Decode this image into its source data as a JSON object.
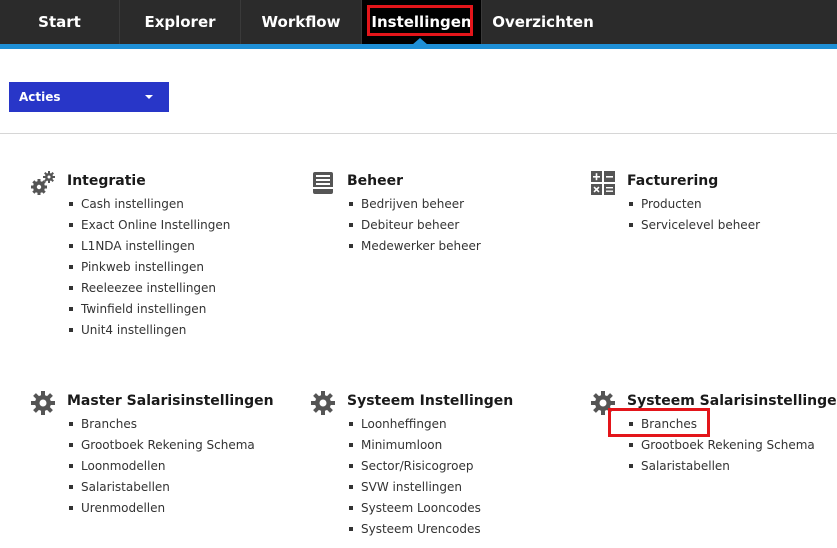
{
  "nav": {
    "tabs": [
      {
        "label": "Start"
      },
      {
        "label": "Explorer"
      },
      {
        "label": "Workflow"
      },
      {
        "label": "Instellingen"
      },
      {
        "label": "Overzichten"
      }
    ],
    "active_tab": "Instellingen",
    "accent_color": "#1e8fd6",
    "highlight_color": "#e3151a"
  },
  "actions": {
    "label": "Acties",
    "color": "#2836c8"
  },
  "sections": [
    {
      "title": "Integratie",
      "icon": "gears-icon",
      "items": [
        "Cash instellingen",
        "Exact Online Instellingen",
        "L1NDA instellingen",
        "Pinkweb instellingen",
        "Reeleezee instellingen",
        "Twinfield instellingen",
        "Unit4 instellingen"
      ]
    },
    {
      "title": "Beheer",
      "icon": "inbox-icon",
      "items": [
        "Bedrijven beheer",
        "Debiteur beheer",
        "Medewerker beheer"
      ]
    },
    {
      "title": "Facturering",
      "icon": "calculator-icon",
      "items": [
        "Producten",
        "Servicelevel beheer"
      ]
    },
    {
      "title": "Master Salarisinstellingen",
      "icon": "gear-icon",
      "items": [
        "Branches",
        "Grootboek Rekening Schema",
        "Loonmodellen",
        "Salaristabellen",
        "Urenmodellen"
      ]
    },
    {
      "title": "Systeem Instellingen",
      "icon": "gear-icon",
      "items": [
        "Loonheffingen",
        "Minimumloon",
        "Sector/Risicogroep",
        "SVW instellingen",
        "Systeem Looncodes",
        "Systeem Urencodes"
      ]
    },
    {
      "title": "Systeem Salarisinstellingen",
      "icon": "gear-icon",
      "items": [
        "Branches",
        "Grootboek Rekening Schema",
        "Salaristabellen"
      ]
    }
  ]
}
